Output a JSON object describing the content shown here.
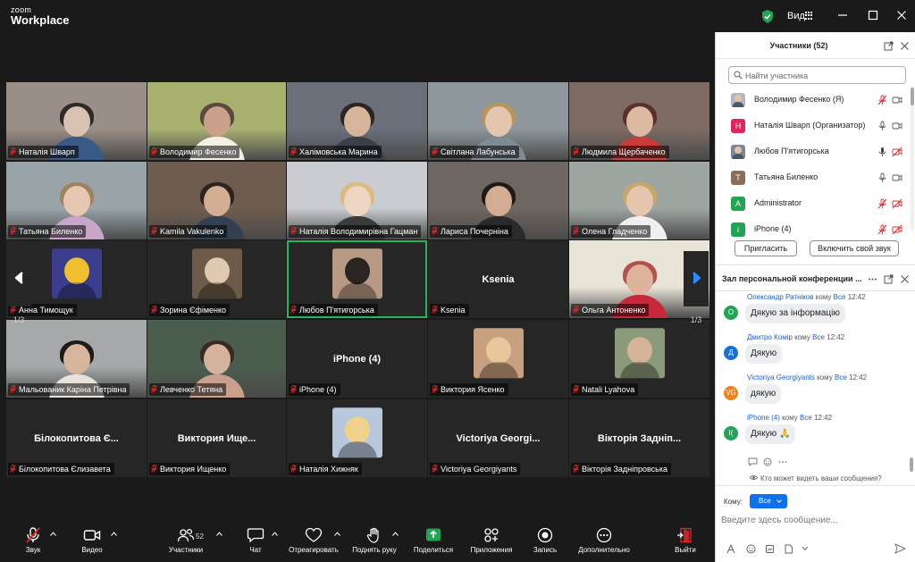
{
  "app": {
    "logo_line1": "zoom",
    "logo_line2": "Workplace",
    "view_label": "Вид"
  },
  "colors": {
    "accent": "#0e72ed",
    "active_speaker": "#1fb85a",
    "muted_red": "#e02828",
    "bg": "#1a1a1a"
  },
  "tiles": [
    {
      "name": "Наталія Шварп",
      "type": "video"
    },
    {
      "name": "Володимир Фесенко",
      "type": "video"
    },
    {
      "name": "Халімовська Марина",
      "type": "video"
    },
    {
      "name": "Світлана Лабунська",
      "type": "video"
    },
    {
      "name": "Людмила Щербаченко",
      "type": "video"
    },
    {
      "name": "Татьяна Биленко",
      "type": "video"
    },
    {
      "name": "Kamila Vakulenko",
      "type": "video"
    },
    {
      "name": "Наталія Володимирівна Гацман",
      "type": "video"
    },
    {
      "name": "Лариса Почерніна",
      "type": "video"
    },
    {
      "name": "Олена Гладченко",
      "type": "video"
    },
    {
      "name": "Анна Тимощук",
      "type": "avatar"
    },
    {
      "name": "Зорина Єфіменко",
      "type": "avatar"
    },
    {
      "name": "Любов П'ятигорська",
      "type": "avatar",
      "active": true
    },
    {
      "name": "Ksenia",
      "type": "text",
      "display": "Ksenia"
    },
    {
      "name": "Ольга Антоненко",
      "type": "video"
    },
    {
      "name": "Мальованик Каріна Петрівна",
      "type": "video"
    },
    {
      "name": "Левченко Тетяна",
      "type": "video"
    },
    {
      "name": "iPhone (4)",
      "type": "text",
      "display": "iPhone (4)"
    },
    {
      "name": "Виктория Ясенко",
      "type": "avatar"
    },
    {
      "name": "Natali Lyahova",
      "type": "avatar"
    },
    {
      "name": "Білокопитова Єлизавета",
      "type": "text",
      "display": "Білокопитова Є..."
    },
    {
      "name": "Виктория Ищенко",
      "type": "text",
      "display": "Виктория Ище..."
    },
    {
      "name": "Наталія Хижняк",
      "type": "avatar"
    },
    {
      "name": "Victoriya Georgiyants",
      "type": "text",
      "display": "Victoriya Georgi..."
    },
    {
      "name": "Вікторія Задніпровська",
      "type": "text",
      "display": "Вікторія Задніп..."
    }
  ],
  "pager": {
    "left": "1/3",
    "right": "1/3"
  },
  "toolbar": {
    "audio": "Звук",
    "video": "Видео",
    "participants": "Участники",
    "participants_count": "52",
    "chat": "Чат",
    "react": "Отреагировать",
    "raise_hand": "Поднять руку",
    "share": "Поделиться",
    "apps": "Приложения",
    "record": "Запись",
    "more": "Дополнительно",
    "leave": "Выйти"
  },
  "participants_panel": {
    "title": "Участники (52)",
    "search_placeholder": "Найти участника",
    "list": [
      {
        "name": "Володимир Фесенко (Я)",
        "avatar": "",
        "color": "#b0b8c4",
        "mic": "muted",
        "cam": "on"
      },
      {
        "name": "Наталія Шварп (Организатор)",
        "avatar": "Н",
        "color": "#e0245e",
        "mic": "on",
        "cam": "on"
      },
      {
        "name": "Любов П'ятигорська",
        "avatar": "",
        "color": "#7a8798",
        "mic": "speaking",
        "cam": "off"
      },
      {
        "name": "Татьяна Биленко",
        "avatar": "Т",
        "color": "#8b6e5a",
        "mic": "on",
        "cam": "on"
      },
      {
        "name": "Administrator",
        "avatar": "A",
        "color": "#23a455",
        "mic": "muted",
        "cam": "off"
      },
      {
        "name": "iPhone (4)",
        "avatar": "i",
        "color": "#23a455",
        "mic": "muted",
        "cam": "off"
      }
    ],
    "invite": "Пригласить",
    "unmute": "Включить свой звук"
  },
  "chat_panel": {
    "title": "Зал персональной конференции ...",
    "messages": [
      {
        "sender": "Олександр Ратніков",
        "to_word": "кому",
        "to": "Все",
        "time": "12:42",
        "text": "Дякую за інформацію",
        "avatar": "О",
        "color": "#23a455"
      },
      {
        "sender": "Дмитро Комір",
        "to_word": "кому",
        "to": "Все",
        "time": "12:42",
        "text": "Дякую",
        "avatar": "Д",
        "color": "#1a6fd6"
      },
      {
        "sender": "Victoriya Georgiyants",
        "to_word": "кому",
        "to": "Все",
        "time": "12:42",
        "text": "дякую",
        "avatar": "VG",
        "color": "#f2811d"
      },
      {
        "sender": "iPhone (4)",
        "to_word": "кому",
        "to": "Все",
        "time": "12:42",
        "text": "Дякую 🙏",
        "avatar": "I(",
        "color": "#23a455"
      }
    ],
    "who_can_see": "Кто может видеть ваши сообщения?",
    "to_label": "Кому:",
    "to_value": "Все",
    "input_placeholder": "Введите здесь сообщение..."
  }
}
